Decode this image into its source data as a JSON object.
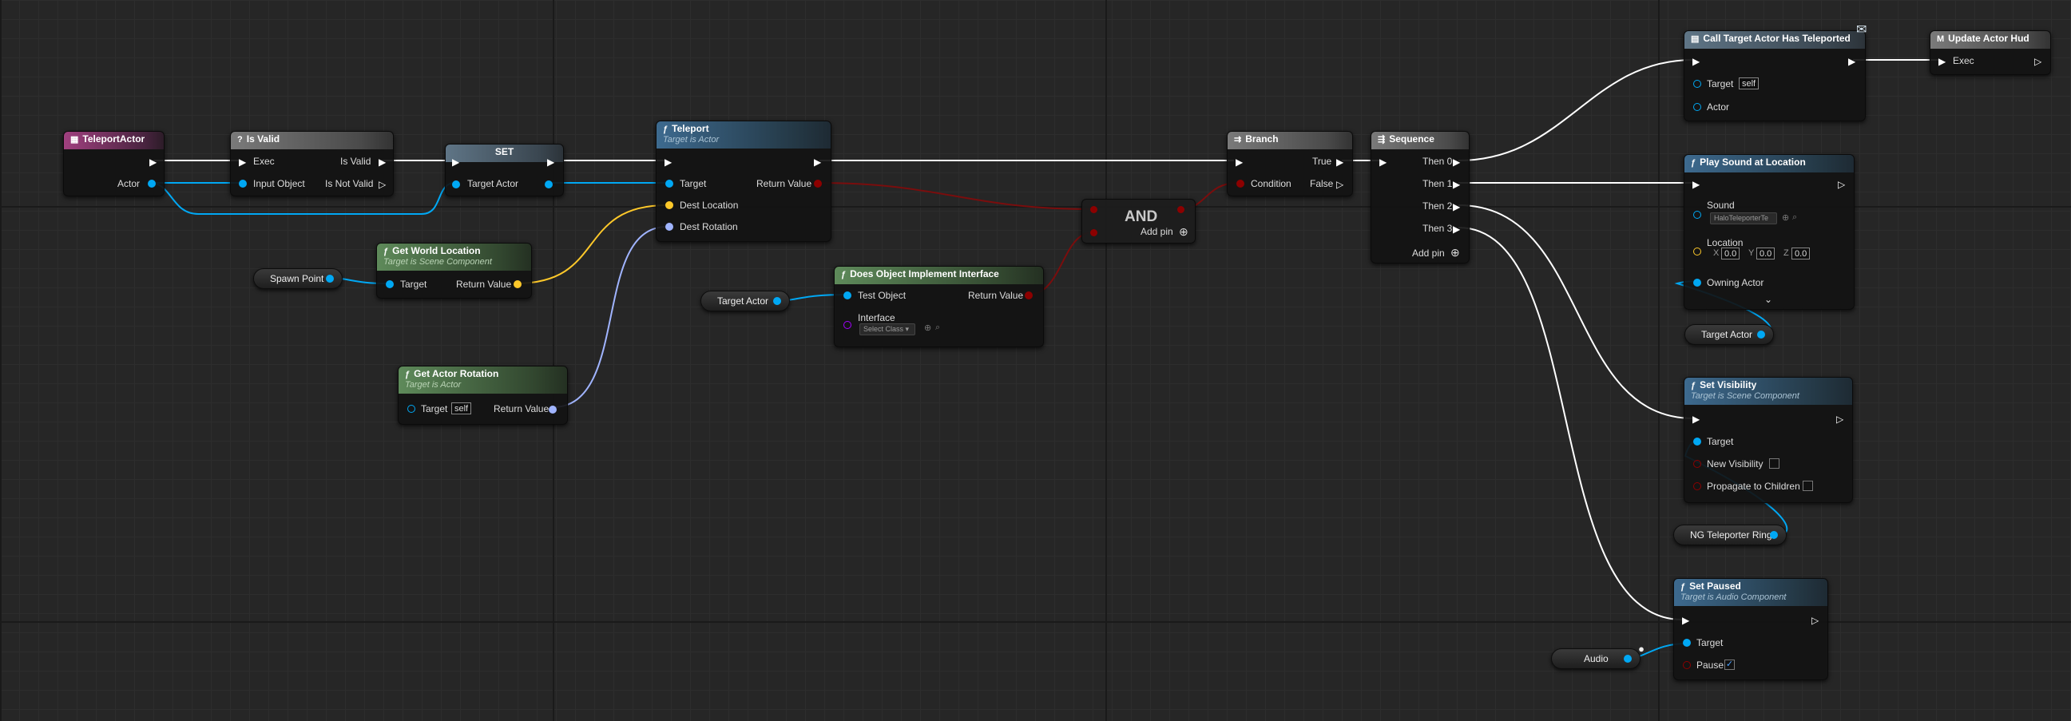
{
  "nodes": {
    "teleport_actor": {
      "title": "TeleportActor",
      "actor": "Actor"
    },
    "is_valid": {
      "title": "Is Valid",
      "exec": "Exec",
      "input_object": "Input Object",
      "is_valid": "Is Valid",
      "is_not_valid": "Is Not Valid"
    },
    "set": {
      "title": "SET",
      "target_actor": "Target Actor"
    },
    "teleport": {
      "title": "Teleport",
      "subtitle": "Target is Actor",
      "target": "Target",
      "dest_location": "Dest Location",
      "dest_rotation": "Dest Rotation",
      "return_value": "Return Value"
    },
    "get_world_location": {
      "title": "Get World Location",
      "subtitle": "Target is Scene Component",
      "target": "Target",
      "return_value": "Return Value"
    },
    "get_actor_rotation": {
      "title": "Get Actor Rotation",
      "subtitle": "Target is Actor",
      "target": "Target",
      "self": "self",
      "return_value": "Return Value"
    },
    "does_implement": {
      "title": "Does Object Implement Interface",
      "test_object": "Test Object",
      "return_value": "Return Value",
      "interface": "Interface",
      "select_class": "Select Class"
    },
    "and": {
      "title": "AND",
      "add_pin": "Add pin"
    },
    "branch": {
      "title": "Branch",
      "true": "True",
      "false": "False",
      "condition": "Condition"
    },
    "sequence": {
      "title": "Sequence",
      "then0": "Then 0",
      "then1": "Then 1",
      "then2": "Then 2",
      "then3": "Then 3",
      "add_pin": "Add pin"
    },
    "call_target": {
      "title": "Call Target Actor Has Teleported",
      "target": "Target",
      "self": "self",
      "actor": "Actor"
    },
    "update_hud": {
      "title": "Update Actor Hud",
      "exec": "Exec"
    },
    "play_sound": {
      "title": "Play Sound at Location",
      "sound": "Sound",
      "sound_value": "HaloTeleporterTe",
      "location": "Location",
      "x_label": "X",
      "x": "0.0",
      "y_label": "Y",
      "y": "0.0",
      "z_label": "Z",
      "z": "0.0",
      "owning_actor": "Owning Actor"
    },
    "set_visibility": {
      "title": "Set Visibility",
      "subtitle": "Target is Scene Component",
      "target": "Target",
      "new_visibility": "New Visibility",
      "propagate": "Propagate to Children"
    },
    "set_paused": {
      "title": "Set Paused",
      "subtitle": "Target is Audio Component",
      "target": "Target",
      "pause": "Pause",
      "pause_check": "✓"
    }
  },
  "variables": {
    "spawn_point": "Spawn Point",
    "target_actor_1": "Target Actor",
    "target_actor_2": "Target Actor",
    "ng_rings": "NG Teleporter Rings",
    "audio": "Audio"
  },
  "icons": {
    "function": "ƒ",
    "macro": "M",
    "event": "event-icon",
    "branch": "branch-icon",
    "sequence": "sequence-icon",
    "message": "envelope-icon",
    "add": "⊕",
    "dropdown": "▾",
    "expand": "⌄"
  },
  "colors": {
    "exec": "#ffffff",
    "object": "#00a8f4",
    "boolean": "#8c0000",
    "vector": "#fdc82a",
    "rotator": "#a0b4ff",
    "interface": "#a200ff"
  }
}
